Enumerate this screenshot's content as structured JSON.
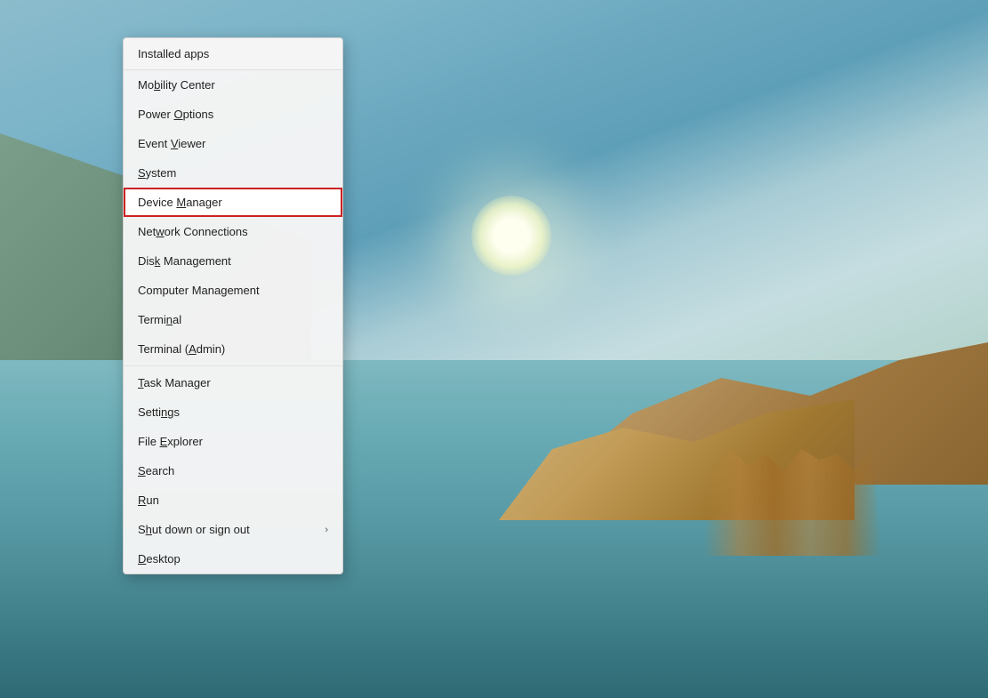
{
  "background": {
    "description": "Windows desktop background with lake and dunes scene"
  },
  "contextMenu": {
    "header": "Installed apps",
    "items": [
      {
        "id": "mobility-center",
        "label": "Mobility Center",
        "underline": 1,
        "highlighted": false,
        "hasSubmenu": false,
        "dividerAfter": false
      },
      {
        "id": "power-options",
        "label": "Power Options",
        "underline": 6,
        "highlighted": false,
        "hasSubmenu": false,
        "dividerAfter": false
      },
      {
        "id": "event-viewer",
        "label": "Event Viewer",
        "underline": 6,
        "highlighted": false,
        "hasSubmenu": false,
        "dividerAfter": false
      },
      {
        "id": "system",
        "label": "System",
        "underline": 1,
        "highlighted": false,
        "hasSubmenu": false,
        "dividerAfter": false
      },
      {
        "id": "device-manager",
        "label": "Device Manager",
        "underline": 7,
        "highlighted": true,
        "hasSubmenu": false,
        "dividerAfter": false
      },
      {
        "id": "network-connections",
        "label": "Network Connections",
        "underline": 3,
        "highlighted": false,
        "hasSubmenu": false,
        "dividerAfter": false
      },
      {
        "id": "disk-management",
        "label": "Disk Management",
        "underline": 3,
        "highlighted": false,
        "hasSubmenu": false,
        "dividerAfter": false
      },
      {
        "id": "computer-management",
        "label": "Computer Management",
        "underline": 8,
        "highlighted": false,
        "hasSubmenu": false,
        "dividerAfter": false
      },
      {
        "id": "terminal",
        "label": "Terminal",
        "underline": 4,
        "highlighted": false,
        "hasSubmenu": false,
        "dividerAfter": false
      },
      {
        "id": "terminal-admin",
        "label": "Terminal (Admin)",
        "underline": 9,
        "highlighted": false,
        "hasSubmenu": false,
        "dividerAfter": true
      },
      {
        "id": "task-manager",
        "label": "Task Manager",
        "underline": 1,
        "highlighted": false,
        "hasSubmenu": false,
        "dividerAfter": false
      },
      {
        "id": "settings",
        "label": "Settings",
        "underline": 1,
        "highlighted": false,
        "hasSubmenu": false,
        "dividerAfter": false
      },
      {
        "id": "file-explorer",
        "label": "File Explorer",
        "underline": 5,
        "highlighted": false,
        "hasSubmenu": false,
        "dividerAfter": false
      },
      {
        "id": "search",
        "label": "Search",
        "underline": 1,
        "highlighted": false,
        "hasSubmenu": false,
        "dividerAfter": false
      },
      {
        "id": "run",
        "label": "Run",
        "underline": 1,
        "highlighted": false,
        "hasSubmenu": false,
        "dividerAfter": false
      },
      {
        "id": "shut-down",
        "label": "Shut down or sign out",
        "underline": 2,
        "highlighted": false,
        "hasSubmenu": true,
        "dividerAfter": false
      },
      {
        "id": "desktop",
        "label": "Desktop",
        "underline": 1,
        "highlighted": false,
        "hasSubmenu": false,
        "dividerAfter": false
      }
    ]
  }
}
